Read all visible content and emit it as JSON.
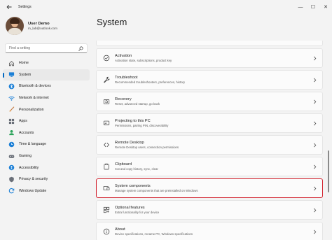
{
  "app": {
    "title": "Settings",
    "back_icon": "back-arrow-icon"
  },
  "window_controls": {
    "minimize": "—",
    "maximize": "☐",
    "close": "✕"
  },
  "profile": {
    "name": "User Demo",
    "email": "m_lab@outlook.com"
  },
  "search": {
    "placeholder": "Find a setting",
    "value": ""
  },
  "nav": {
    "items": [
      {
        "label": "Home",
        "icon": "home-icon",
        "active": false
      },
      {
        "label": "System",
        "icon": "system-icon",
        "active": true
      },
      {
        "label": "Bluetooth & devices",
        "icon": "bluetooth-icon",
        "active": false
      },
      {
        "label": "Network & internet",
        "icon": "network-icon",
        "active": false
      },
      {
        "label": "Personalization",
        "icon": "brush-icon",
        "active": false
      },
      {
        "label": "Apps",
        "icon": "apps-icon",
        "active": false
      },
      {
        "label": "Accounts",
        "icon": "accounts-icon",
        "active": false
      },
      {
        "label": "Time & language",
        "icon": "time-icon",
        "active": false
      },
      {
        "label": "Gaming",
        "icon": "gaming-icon",
        "active": false
      },
      {
        "label": "Accessibility",
        "icon": "accessibility-icon",
        "active": false
      },
      {
        "label": "Privacy & security",
        "icon": "shield-icon",
        "active": false
      },
      {
        "label": "Windows Update",
        "icon": "update-icon",
        "active": false
      }
    ]
  },
  "main": {
    "title": "System",
    "cards": [
      {
        "title": "Activation",
        "subtitle": "Activation state, subscriptions, product key",
        "icon": "activation-icon"
      },
      {
        "title": "Troubleshoot",
        "subtitle": "Recommended troubleshooters, preferences, history",
        "icon": "wrench-icon"
      },
      {
        "title": "Recovery",
        "subtitle": "Reset, advanced startup, go back",
        "icon": "recovery-icon"
      },
      {
        "title": "Projecting to this PC",
        "subtitle": "Permissions, pairing PIN, discoverability",
        "icon": "projecting-icon"
      },
      {
        "title": "Remote Desktop",
        "subtitle": "Remote Desktop users, connection permissions",
        "icon": "remote-desktop-icon"
      },
      {
        "title": "Clipboard",
        "subtitle": "Cut and copy history, sync, clear",
        "icon": "clipboard-icon"
      },
      {
        "title": "System components",
        "subtitle": "Manage system components that are preinstalled on Windows",
        "icon": "system-components-icon",
        "highlighted": true
      },
      {
        "title": "Optional features",
        "subtitle": "Extra functionality for your device",
        "icon": "optional-features-icon"
      },
      {
        "title": "About",
        "subtitle": "Device specifications, rename PC, Windows specifications",
        "icon": "info-icon"
      }
    ]
  },
  "colors": {
    "accent": "#0067c0",
    "highlight_border": "#d2232f",
    "background": "#f3f3f3",
    "card": "#fbfbfb"
  }
}
